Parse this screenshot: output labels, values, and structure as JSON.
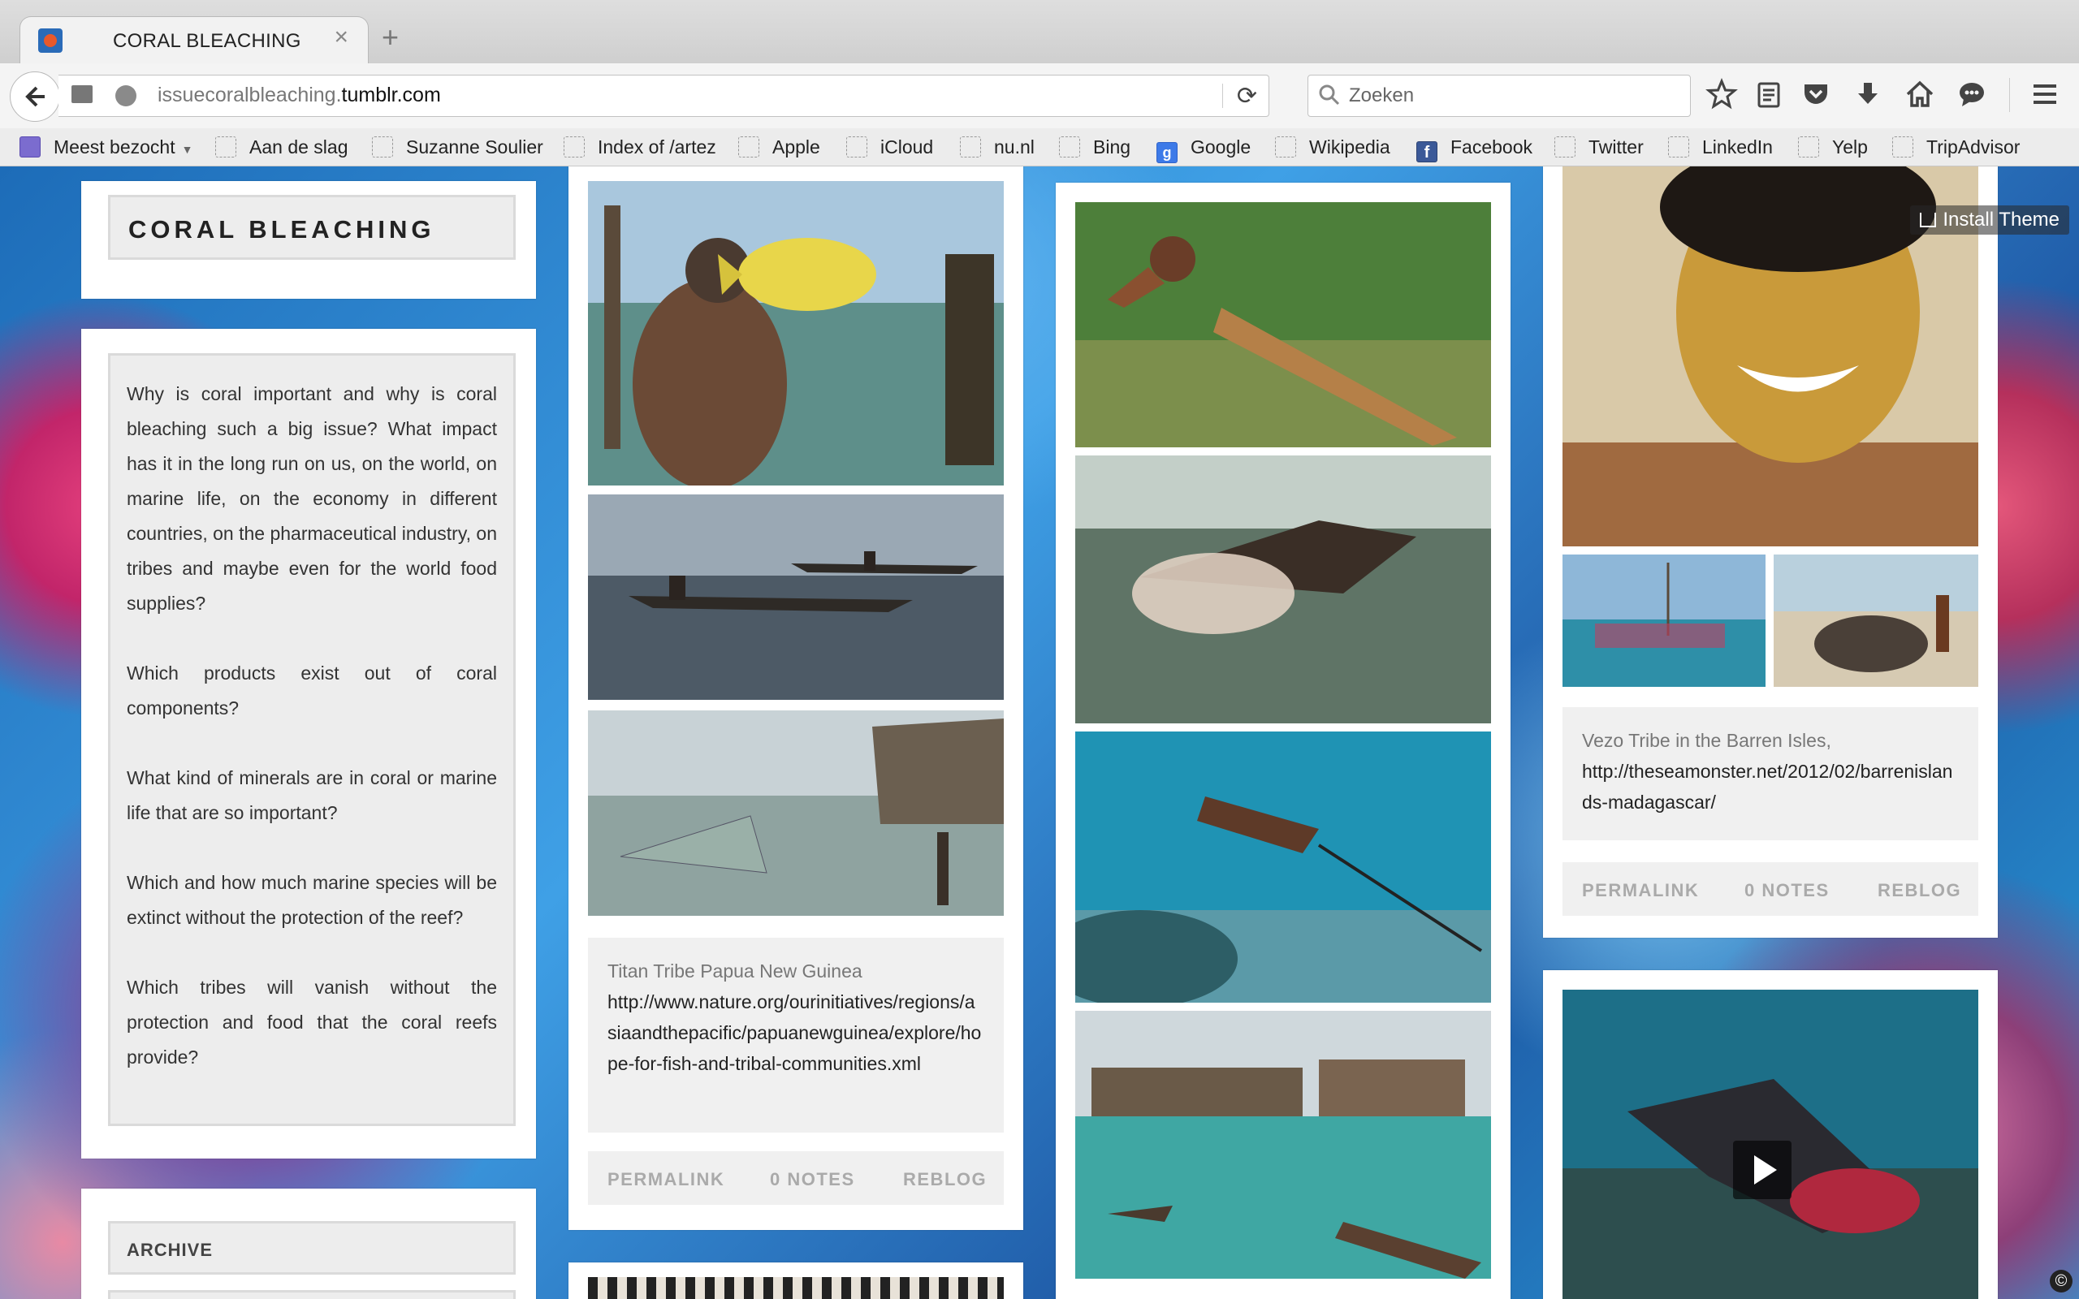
{
  "browser": {
    "tab_title": "CORAL BLEACHING",
    "tab_close": "×",
    "new_tab": "+",
    "url_prefix": "issuecoralbleaching.",
    "url_domain": "tumblr.com",
    "search_placeholder": "Zoeken",
    "bookmarks": [
      "Meest bezocht",
      "Aan de slag",
      "Suzanne Soulier",
      "Index of /artez",
      "Apple",
      "iCloud",
      "nu.nl",
      "Bing",
      "Google",
      "Wikipedia",
      "Facebook",
      "Twitter",
      "LinkedIn",
      "Yelp",
      "TripAdvisor"
    ]
  },
  "blog": {
    "title": "CORAL BLEACHING",
    "description": [
      "Why is coral important and why is coral bleaching such a big issue? What impact has it in the long run on us, on the world, on marine life, on the economy in different countries, on the pharmaceutical industry, on tribes and maybe even for the world food supplies?",
      "Which products exist out of coral components?",
      "What kind of minerals are in coral or marine life that are so important?",
      "Which and how much marine species will be extinct without the protection of the reef?",
      "Which tribes will vanish without the protection and food that the coral reefs provide?"
    ],
    "archive_label": "ARCHIVE",
    "install_theme": "Install Theme",
    "copyright": "©"
  },
  "posts": [
    {
      "caption_title": "Titan Tribe Papua New Guinea",
      "caption_link": "http://www.nature.org/ourinitiatives/regions/asiaandthepacific/papuanewguinea/explore/hope-for-fish-and-tribal-communities.xml",
      "permalink": "PERMALINK",
      "notes": "0 NOTES",
      "reblog": "REBLOG"
    },
    {
      "caption_title": "Vezo Tribe in the Barren Isles,",
      "caption_link": "http://theseamonster.net/2012/02/barrenislands-madagascar/",
      "permalink": "PERMALINK",
      "notes": "0 NOTES",
      "reblog": "REBLOG"
    }
  ]
}
